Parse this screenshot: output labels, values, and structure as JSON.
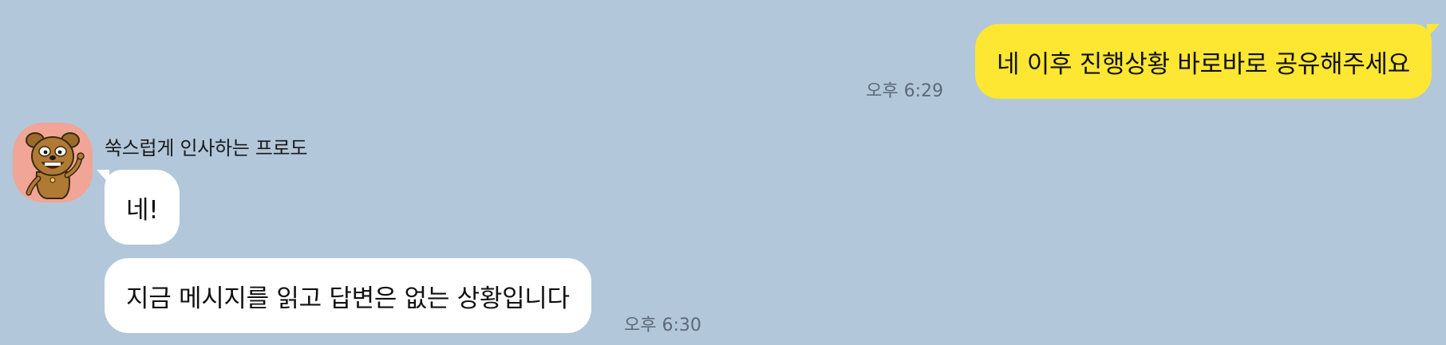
{
  "chat": {
    "messages": [
      {
        "from": "me",
        "text": "네 이후 진행상황 바로바로 공유해주세요",
        "time": "오후 6:29"
      },
      {
        "from": "other",
        "text": "네!",
        "time": ""
      },
      {
        "from": "other",
        "text": "지금 메시지를 읽고 답변은 없는 상황입니다",
        "time": "오후 6:30"
      }
    ],
    "other_sender": {
      "name": "쑥스럽게 인사하는 프로도",
      "avatar": "frodo-dog-character-icon"
    }
  },
  "colors": {
    "background": "#b2c7da",
    "my_bubble": "#fee733",
    "other_bubble": "#ffffff",
    "avatar_bg": "#f0a597",
    "timestamp": "#5b6a78"
  }
}
